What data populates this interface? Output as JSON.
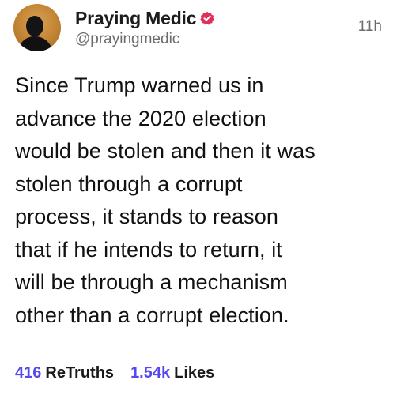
{
  "post": {
    "author": {
      "display_name": "Praying Medic",
      "handle": "@prayingmedic",
      "verified": true,
      "avatar_icon": "profile-photo-silhouette"
    },
    "timestamp": "11h",
    "body_lines": [
      "Since Trump warned us in",
      "advance the 2020 election",
      "would be stolen and then it was",
      "stolen through a corrupt",
      "process, it stands to reason",
      "that if he intends to return, it",
      "will be through a mechanism",
      "other than a corrupt election."
    ],
    "stats": {
      "retruths_count": "416",
      "retruths_label": "ReTruths",
      "likes_count": "1.54k",
      "likes_label": "Likes"
    }
  },
  "colors": {
    "accent": "#5448ee",
    "verified_badge": "#e12f5b",
    "muted_text": "#6b6b6b",
    "avatar_background": "#c78938"
  }
}
